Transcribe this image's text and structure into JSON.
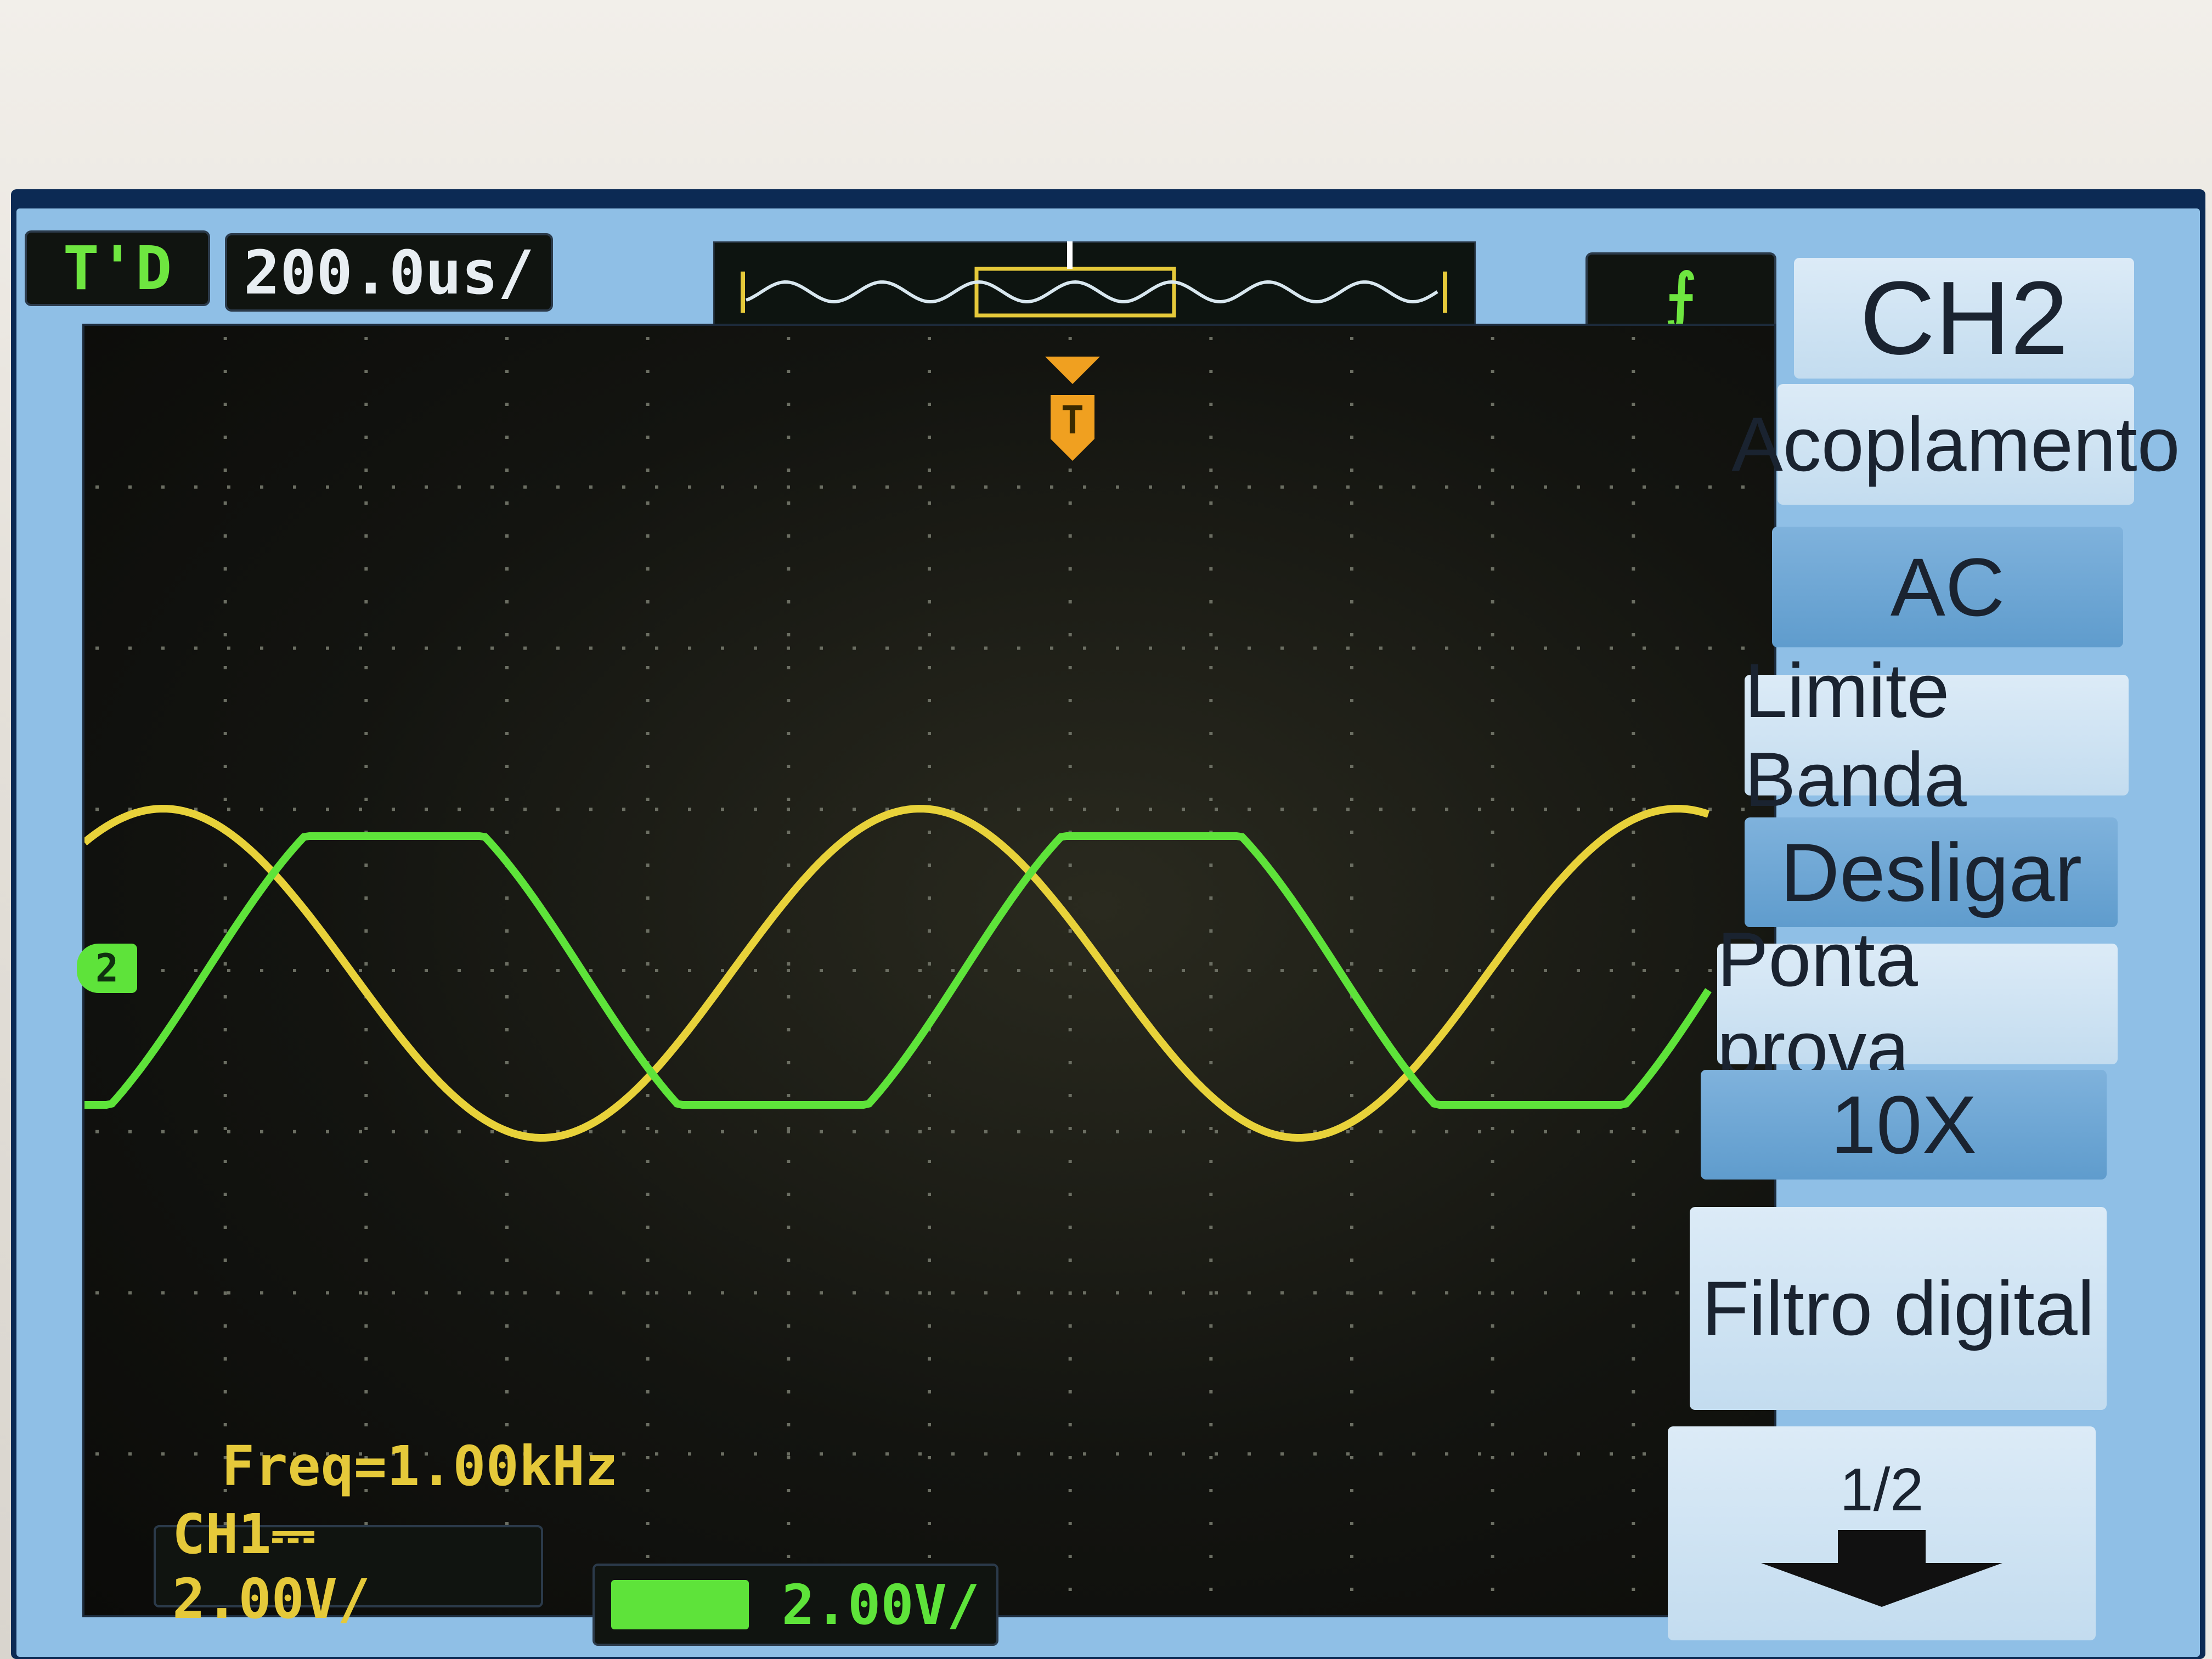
{
  "header": {
    "trigger_status": "T'D",
    "timebase": "200.0us/",
    "trigger_slope_icon": "rising-edge-icon"
  },
  "markers": {
    "trigger_position": "T",
    "channel2_level": "2"
  },
  "side_menu": {
    "title": "CH2",
    "items": [
      {
        "label": "Acoplamento",
        "value": "AC"
      },
      {
        "label": "Limite Banda",
        "value": "Desligar"
      },
      {
        "label": "Ponta prova",
        "value": "10X"
      },
      {
        "label": "Filtro digital",
        "value": ""
      }
    ],
    "page": "1/2",
    "next_icon": "arrow-down-icon"
  },
  "readouts": {
    "frequency": "Freq=1.00kHz",
    "ch1_scale": "CH1⎓ 2.00V/",
    "ch2_scale": "2.00V/"
  },
  "colors": {
    "ch1": "#e8d23a",
    "ch2": "#5ee33a",
    "trigger": "#f0a020"
  }
}
